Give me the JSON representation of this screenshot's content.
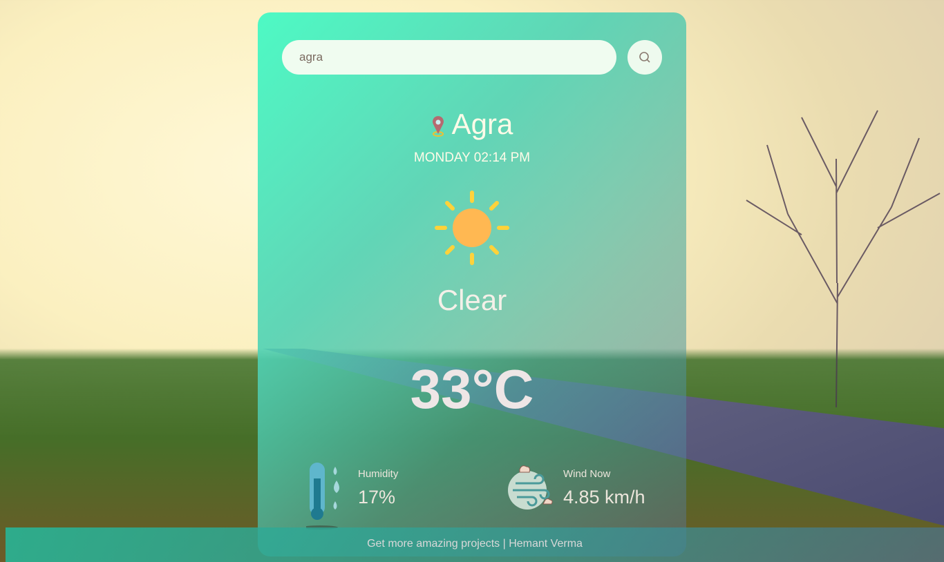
{
  "search": {
    "value": "agra",
    "icon": "search-icon"
  },
  "location": {
    "city": "Agra",
    "icon": "map-pin-icon"
  },
  "datetime": "MONDAY 02:14 PM",
  "weather": {
    "icon": "sun-icon",
    "condition": "Clear",
    "temperature": "33°C"
  },
  "stats": [
    {
      "label": "Humidity",
      "value": "17%",
      "icon": "thermometer-icon"
    },
    {
      "label": "Wind Now",
      "value": "4.85 km/h",
      "icon": "wind-icon"
    }
  ],
  "footer": "Get more amazing projects | Hemant Verma",
  "colors": {
    "accent": "#48fac4",
    "text": "#fffbe8"
  }
}
